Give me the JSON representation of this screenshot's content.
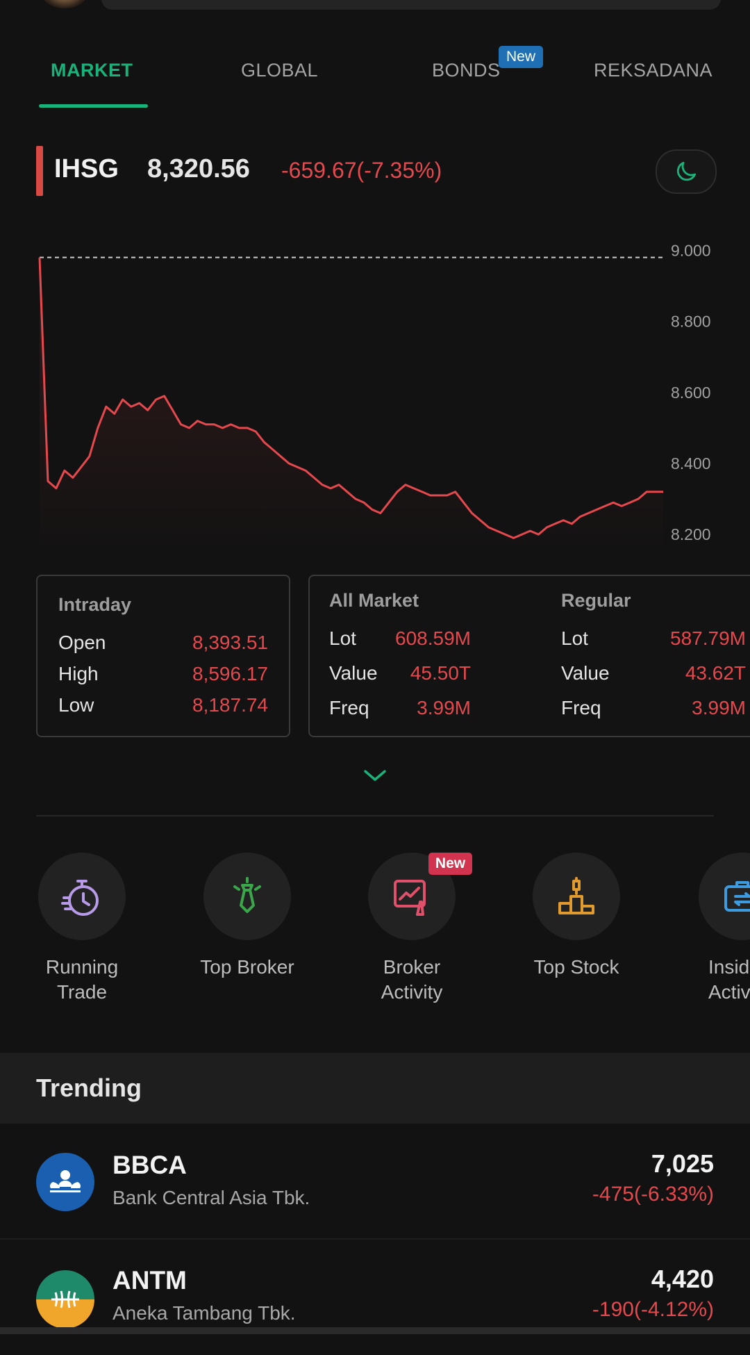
{
  "tabs": [
    {
      "label": "MARKET",
      "active": true
    },
    {
      "label": "GLOBAL",
      "active": false
    },
    {
      "label": "BONDS",
      "active": false,
      "badge": "New"
    },
    {
      "label": "REKSADANA",
      "active": false
    }
  ],
  "index": {
    "name": "IHSG",
    "value": "8,320.56",
    "change": "-659.67(-7.35%)",
    "theme_icon": "moon-icon"
  },
  "chart_data": {
    "type": "line",
    "yticks": [
      "9.000",
      "8.800",
      "8.600",
      "8.400",
      "8.200"
    ],
    "ylim": [
      8120,
      9040
    ],
    "reference_line": 8980.23,
    "y": [
      8980,
      8350,
      8330,
      8380,
      8360,
      8390,
      8420,
      8500,
      8560,
      8540,
      8580,
      8560,
      8570,
      8550,
      8580,
      8590,
      8550,
      8510,
      8500,
      8520,
      8510,
      8510,
      8500,
      8510,
      8500,
      8500,
      8490,
      8460,
      8440,
      8420,
      8400,
      8390,
      8380,
      8360,
      8340,
      8330,
      8340,
      8320,
      8300,
      8290,
      8270,
      8260,
      8290,
      8320,
      8340,
      8330,
      8320,
      8310,
      8310,
      8310,
      8320,
      8290,
      8260,
      8240,
      8220,
      8210,
      8200,
      8190,
      8200,
      8210,
      8200,
      8220,
      8230,
      8240,
      8230,
      8250,
      8260,
      8270,
      8280,
      8290,
      8280,
      8290,
      8300,
      8320,
      8320,
      8320
    ],
    "color": "#e5484d"
  },
  "intraday": {
    "title": "Intraday",
    "rows": [
      {
        "label": "Open",
        "value": "8,393.51"
      },
      {
        "label": "High",
        "value": "8,596.17"
      },
      {
        "label": "Low",
        "value": "8,187.74"
      }
    ]
  },
  "all_market": {
    "title": "All Market",
    "rows": [
      {
        "label": "Lot",
        "value": "608.59M"
      },
      {
        "label": "Value",
        "value": "45.50T"
      },
      {
        "label": "Freq",
        "value": "3.99M"
      }
    ]
  },
  "regular": {
    "title": "Regular",
    "rows": [
      {
        "label": "Lot",
        "value": "587.79M"
      },
      {
        "label": "Value",
        "value": "43.62T"
      },
      {
        "label": "Freq",
        "value": "3.99M"
      }
    ]
  },
  "quick_actions": [
    {
      "line1": "Running",
      "line2": "Trade",
      "icon": "running-trade-icon",
      "color": "#b89be8"
    },
    {
      "line1": "Top Broker",
      "line2": "",
      "icon": "top-broker-icon",
      "color": "#3aa84a"
    },
    {
      "line1": "Broker",
      "line2": "Activity",
      "icon": "broker-activity-icon",
      "color": "#e0506a",
      "badge": "New"
    },
    {
      "line1": "Top Stock",
      "line2": "",
      "icon": "top-stock-icon",
      "color": "#e09a2e"
    },
    {
      "line1": "Insid",
      "line2": "Activ",
      "icon": "insider-activity-icon",
      "color": "#3d9be0"
    }
  ],
  "trending": {
    "title": "Trending",
    "items": [
      {
        "ticker": "BBCA",
        "name": "Bank Central Asia Tbk.",
        "price": "7,025",
        "change": "-475(-6.33%)",
        "logo": "bbca-logo"
      },
      {
        "ticker": "ANTM",
        "name": "Aneka Tambang Tbk.",
        "price": "4,420",
        "change": "-190(-4.12%)",
        "logo": "antm-logo"
      }
    ]
  },
  "expand_icon": "chevron-down-icon"
}
